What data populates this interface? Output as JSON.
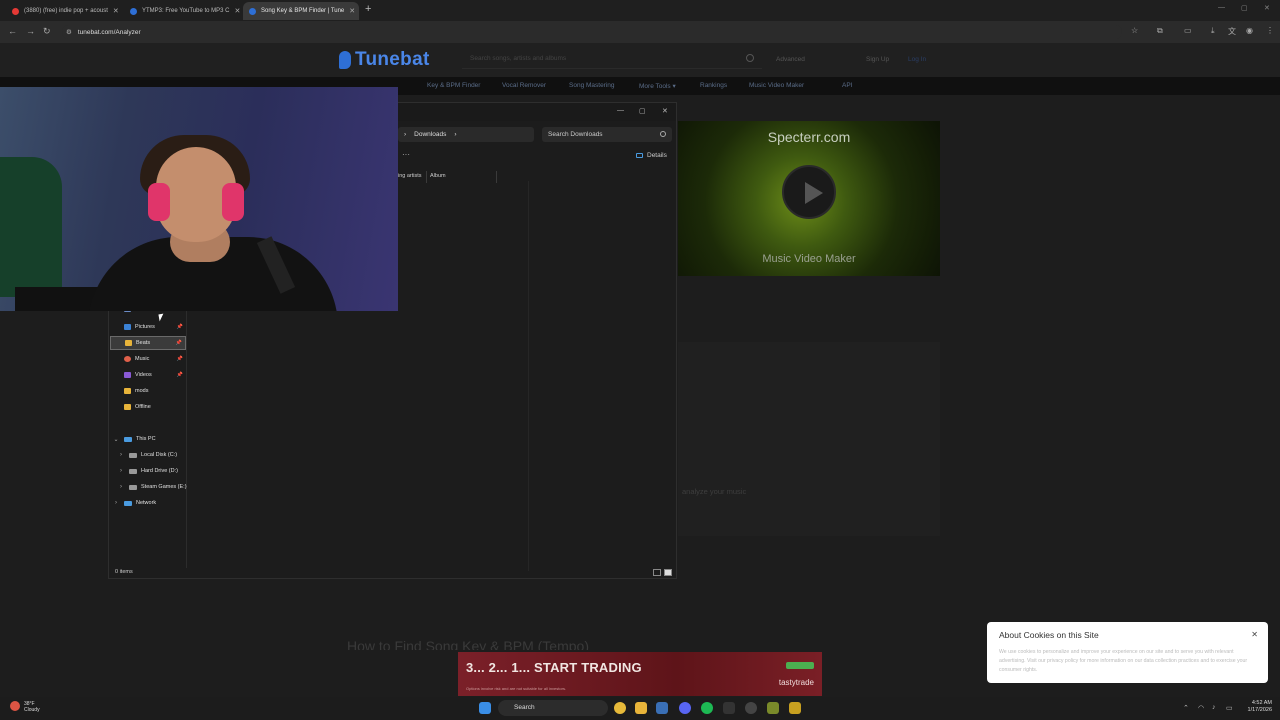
{
  "browser": {
    "tabs": [
      {
        "title": "(3880) (free) indie pop + acoust",
        "favicon_color": "#e53935",
        "active": false
      },
      {
        "title": "YTMP3: Free YouTube to MP3 C",
        "favicon_color": "#2e6fd6",
        "active": false
      },
      {
        "title": "Song Key & BPM Finder | Tune",
        "favicon_color": "#2e6fd6",
        "active": true
      }
    ],
    "url": "tunebat.com/Analyzer"
  },
  "site": {
    "logo": "Tunebat",
    "search_placeholder": "Search songs, artists and albums",
    "advanced": "Advanced",
    "sign_up": "Sign Up",
    "log_in": "Log In",
    "nav": [
      "Key & BPM Finder",
      "Vocal Remover",
      "Song Mastering",
      "More Tools ▾",
      "Rankings",
      "Music Video Maker",
      "API"
    ],
    "ad": {
      "heading": "Specterr.com",
      "footer": "Music Video Maker"
    },
    "dropzone_text": "analyze your music",
    "blur_heading": "How to Find Song Key & BPM (Tempo)"
  },
  "explorer": {
    "breadcrumb": "Downloads",
    "search_placeholder": "Search Downloads",
    "details_label": "Details",
    "more_label": "···",
    "columns": [
      "ing artists",
      "Album"
    ],
    "quick_access": [
      {
        "label": "Documents",
        "color": "#6b8cc7",
        "pinned": true,
        "selected": false
      },
      {
        "label": "Pictures",
        "color": "#3b82d6",
        "pinned": true,
        "selected": false
      },
      {
        "label": "Beats",
        "color": "#e8b43a",
        "pinned": true,
        "selected": true
      },
      {
        "label": "Music",
        "color": "#e0604a",
        "pinned": true,
        "selected": false
      },
      {
        "label": "Videos",
        "color": "#8a5ad6",
        "pinned": true,
        "selected": false
      },
      {
        "label": "mods",
        "color": "#e8b43a",
        "pinned": false,
        "selected": false
      },
      {
        "label": "Offline",
        "color": "#e8b43a",
        "pinned": false,
        "selected": false
      }
    ],
    "this_pc": "This PC",
    "drives": [
      "Local Disk (C:)",
      "Hard Drive (D:)",
      "Steam Games (E:)"
    ],
    "network": "Network",
    "status": "0 items"
  },
  "cookie": {
    "title": "About Cookies on this Site",
    "body": "We use cookies to personalize and improve your experience on our site and to serve you with relevant advertising. Visit our privacy policy for more information on our data collection practices and to exercise your consumer rights."
  },
  "bottom_ad": {
    "headline": "3... 2... 1... START TRADING",
    "brand": "tastytrade",
    "fine_print": "Options involve risk and are not suitable for all investors."
  },
  "taskbar": {
    "weather_temp": "38°F",
    "weather_desc": "Cloudy",
    "search_label": "Search",
    "time": "4:52 AM",
    "date": "1/17/2026"
  }
}
